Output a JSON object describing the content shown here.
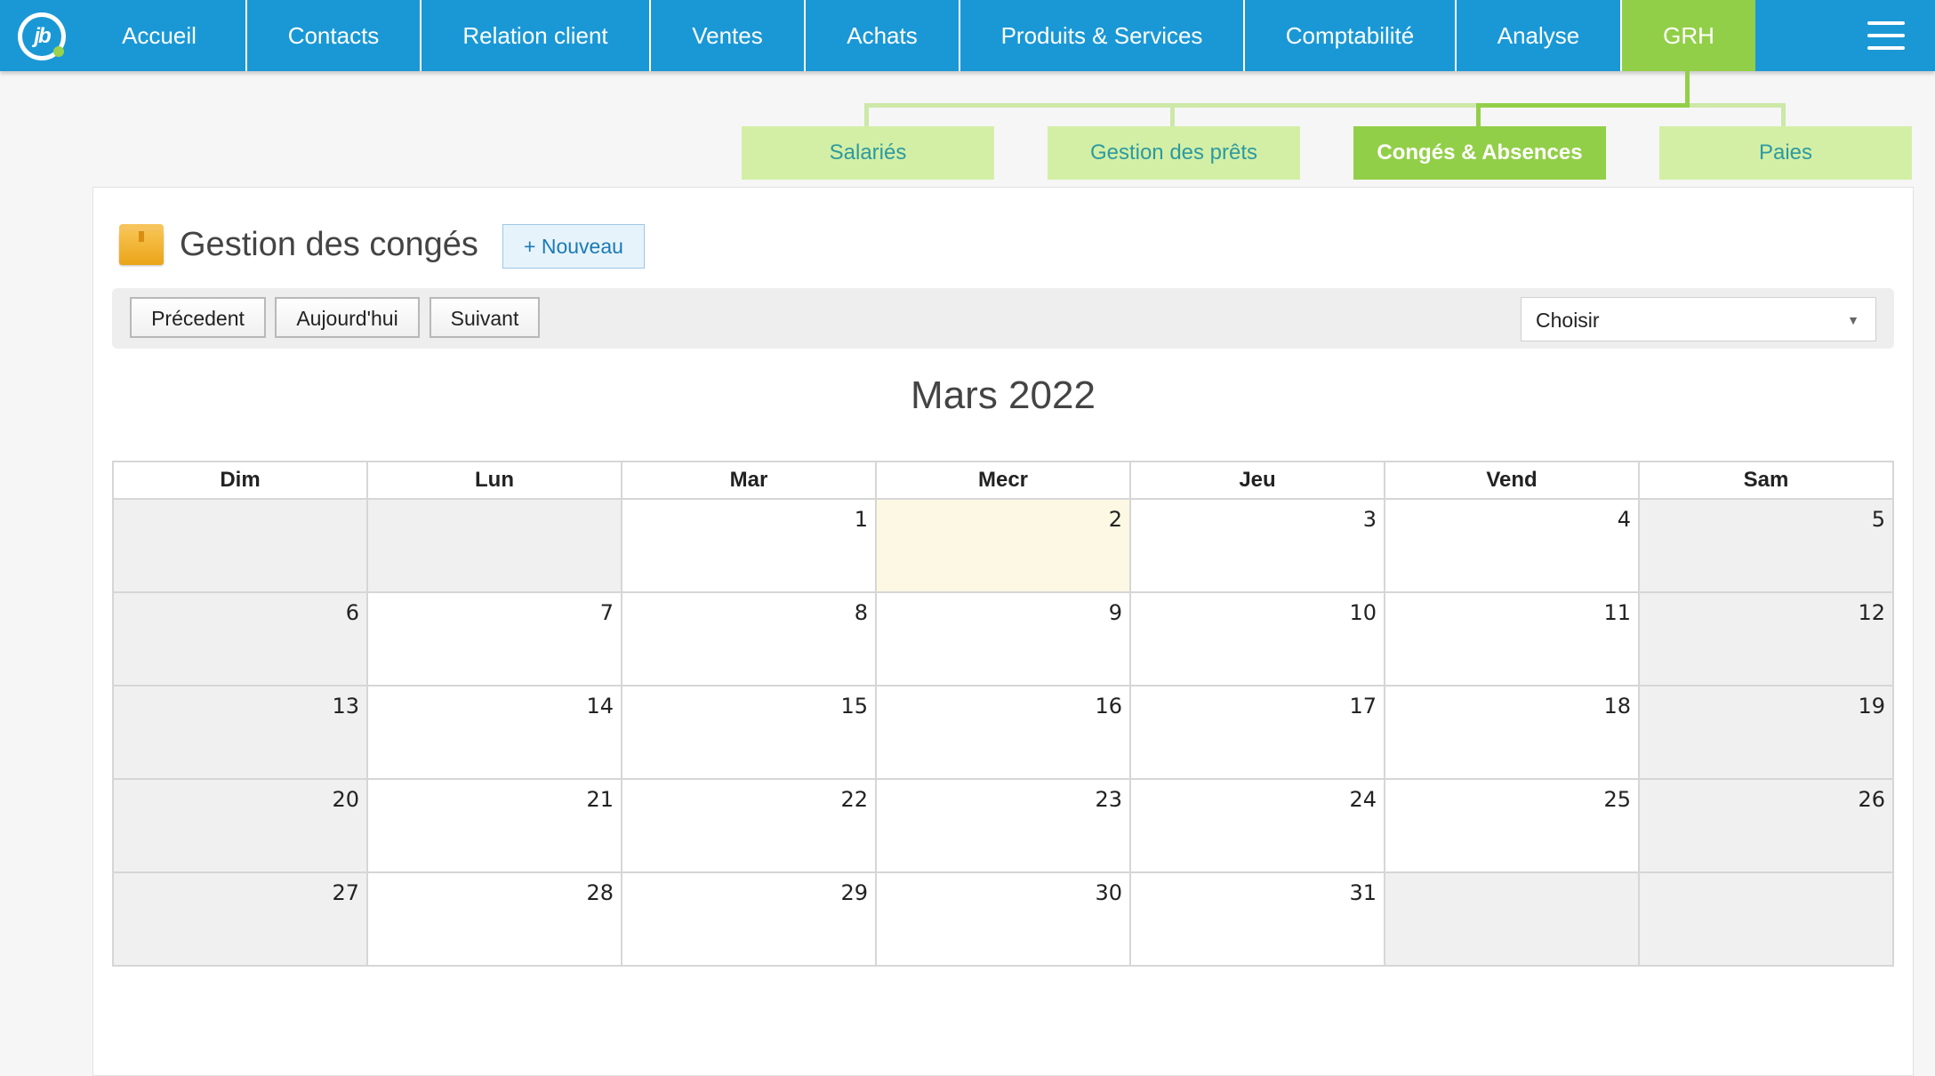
{
  "nav": {
    "items": [
      "Accueil",
      "Contacts",
      "Relation client",
      "Ventes",
      "Achats",
      "Produits & Services",
      "Comptabilité",
      "Analyse",
      "GRH"
    ],
    "active": "GRH"
  },
  "subnav": {
    "items": [
      "Salariés",
      "Gestion des prêts",
      "Congés & Absences",
      "Paies"
    ],
    "active": "Congés & Absences"
  },
  "page": {
    "title": "Gestion des congés",
    "new_button": "+ Nouveau"
  },
  "toolbar": {
    "prev": "Précedent",
    "today": "Aujourd'hui",
    "next": "Suivant",
    "select_value": "Choisir"
  },
  "calendar": {
    "month_title": "Mars 2022",
    "weekdays": [
      "Dim",
      "Lun",
      "Mar",
      "Mecr",
      "Jeu",
      "Vend",
      "Sam"
    ],
    "weeks": [
      [
        "",
        "",
        "1",
        "2",
        "3",
        "4",
        "5"
      ],
      [
        "6",
        "7",
        "8",
        "9",
        "10",
        "11",
        "12"
      ],
      [
        "13",
        "14",
        "15",
        "16",
        "17",
        "18",
        "19"
      ],
      [
        "20",
        "21",
        "22",
        "23",
        "24",
        "25",
        "26"
      ],
      [
        "27",
        "28",
        "29",
        "30",
        "31",
        "",
        ""
      ]
    ],
    "today": "2"
  },
  "colors": {
    "nav_bg": "#1a98d6",
    "nav_active": "#92cf48",
    "subnav_bg": "#d3efa5",
    "subnav_text": "#2d9aa0",
    "today_bg": "#fcf8e3"
  }
}
